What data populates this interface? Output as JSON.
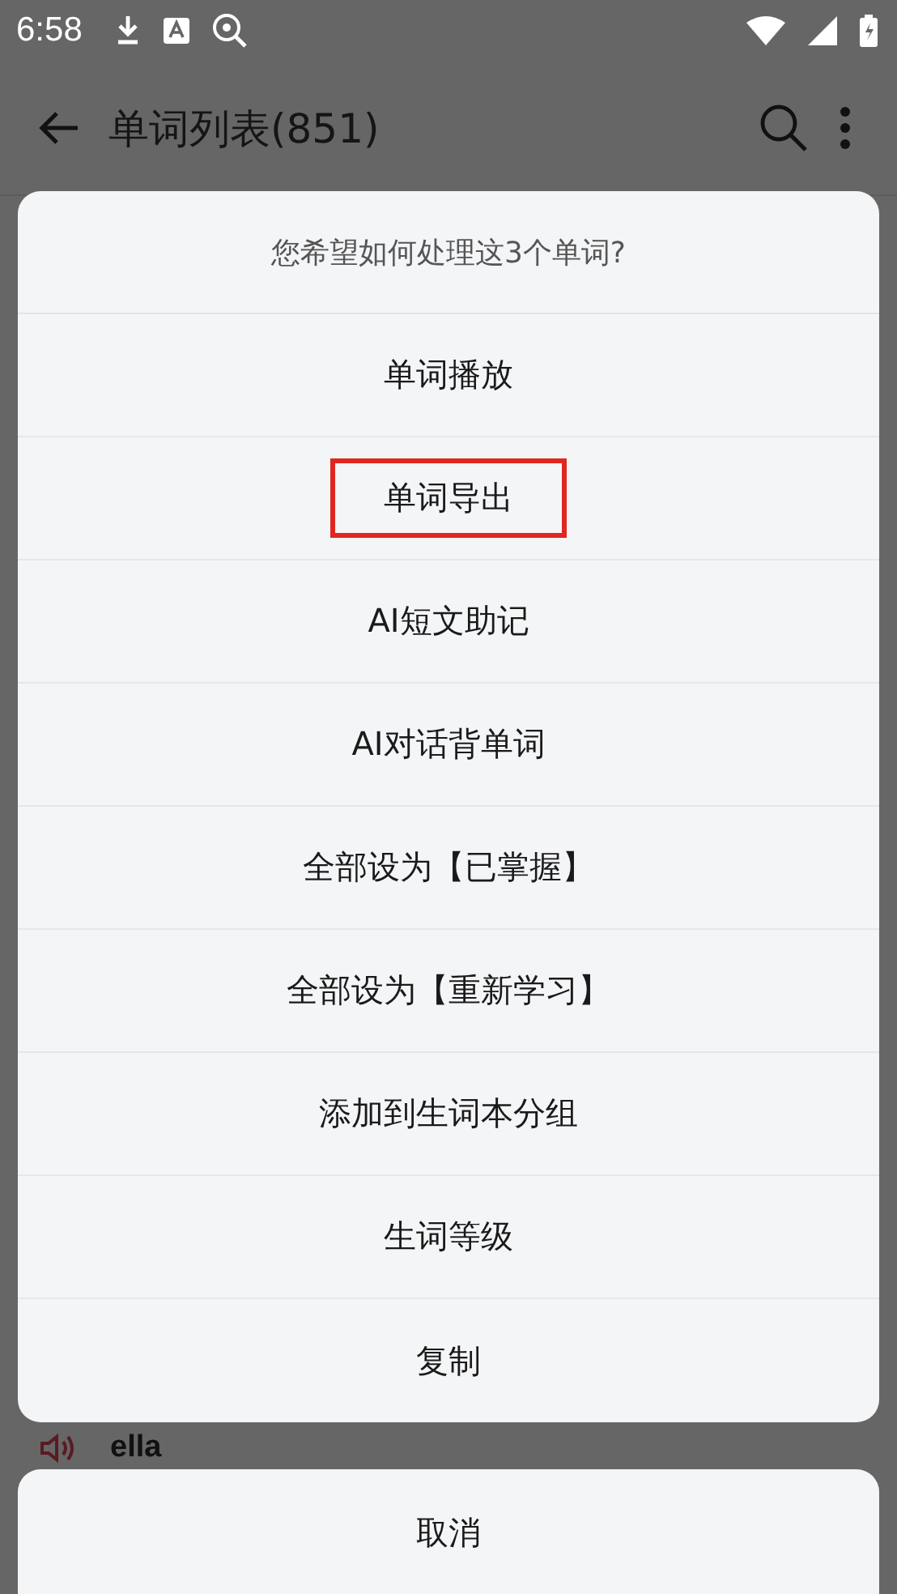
{
  "status_bar": {
    "time": "6:58"
  },
  "app_bar": {
    "title": "单词列表(851)"
  },
  "word_list": [
    {
      "word": "ella"
    }
  ],
  "dialog": {
    "title": "您希望如何处理这3个单词?",
    "items": [
      {
        "label": "单词播放",
        "highlighted": false
      },
      {
        "label": "单词导出",
        "highlighted": true
      },
      {
        "label": "AI短文助记",
        "highlighted": false
      },
      {
        "label": "AI对话背单词",
        "highlighted": false
      },
      {
        "label": "全部设为【已掌握】",
        "highlighted": false
      },
      {
        "label": "全部设为【重新学习】",
        "highlighted": false
      },
      {
        "label": "添加到生词本分组",
        "highlighted": false
      },
      {
        "label": "生词等级",
        "highlighted": false
      },
      {
        "label": "复制",
        "highlighted": false
      }
    ],
    "cancel": "取消"
  }
}
